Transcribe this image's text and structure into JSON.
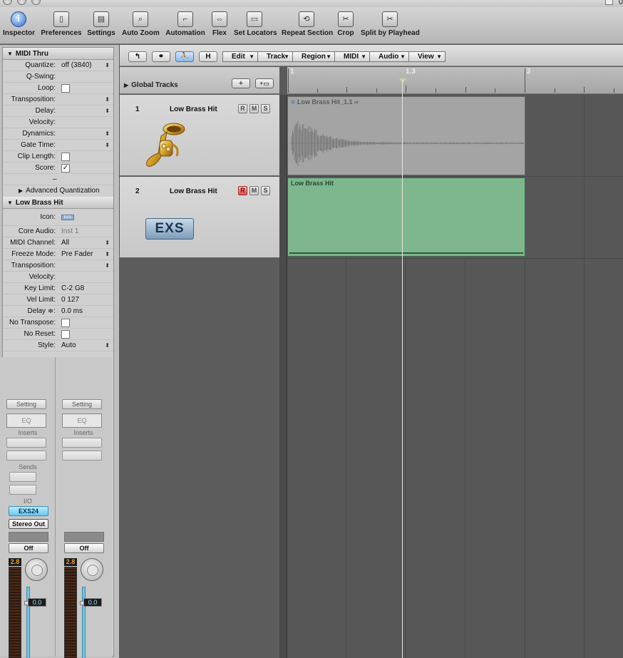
{
  "window": {
    "edge_glyph": "0"
  },
  "toolbar": {
    "items": [
      {
        "label": "Inspector",
        "glyph": "i",
        "icon": "inspector-icon"
      },
      {
        "label": "Preferences",
        "glyph": "▯",
        "icon": "preferences-icon"
      },
      {
        "label": "Settings",
        "glyph": "▤",
        "icon": "settings-icon"
      },
      {
        "label": "Auto Zoom",
        "glyph": "⌕",
        "icon": "auto-zoom-icon"
      },
      {
        "label": "Automation",
        "glyph": "⌐",
        "icon": "automation-icon"
      },
      {
        "label": "Flex",
        "glyph": "⇔",
        "icon": "flex-icon"
      },
      {
        "label": "Set Locators",
        "glyph": "▭",
        "icon": "set-locators-icon"
      },
      {
        "label": "Repeat Section",
        "glyph": "⟲",
        "icon": "repeat-section-icon"
      },
      {
        "label": "Crop",
        "glyph": "✂",
        "icon": "crop-icon"
      },
      {
        "label": "Split by Playhead",
        "glyph": "✂",
        "icon": "split-by-playhead-icon"
      }
    ]
  },
  "inspector": {
    "region_section": {
      "title": "MIDI Thru",
      "params": [
        {
          "label": "Quantize:",
          "value": "off (3840)",
          "stepper": true
        },
        {
          "label": "Q-Swing:",
          "value": ""
        },
        {
          "label": "Loop:",
          "checkbox": "",
          "is_check": true
        },
        {
          "label": "Transposition:",
          "value": "",
          "stepper": true
        },
        {
          "label": "Delay:",
          "value": "",
          "stepper": true
        },
        {
          "label": "Velocity:",
          "value": ""
        },
        {
          "label": "Dynamics:",
          "value": "",
          "stepper": true
        },
        {
          "label": "Gate Time:",
          "value": "",
          "stepper": true
        },
        {
          "label": "Clip Length:",
          "checkbox": "",
          "is_check": true
        },
        {
          "label": "Score:",
          "checkbox": "✓",
          "is_check": true
        }
      ],
      "separator": "–",
      "advanced_quantization": "Advanced Quantization"
    },
    "track_section": {
      "title": "Low Brass Hit",
      "icon_label": "Icon:",
      "icon_badge": "EXS",
      "params": [
        {
          "label": "Core Audio:",
          "value": "Inst 1",
          "dim": true
        },
        {
          "label": "MIDI Channel:",
          "value": "All",
          "stepper": true
        },
        {
          "label": "Freeze Mode:",
          "value": "Pre Fader",
          "stepper": true
        },
        {
          "label": "Transposition:",
          "value": "",
          "stepper": true
        },
        {
          "label": "Velocity:",
          "value": ""
        },
        {
          "label": "Key Limit:",
          "value": "C-2   G8"
        },
        {
          "label": "Vel Limit:",
          "value": "0       127"
        },
        {
          "label": "Delay ≑:",
          "value": "0.0 ms"
        },
        {
          "label": "No Transpose:",
          "checkbox": "",
          "is_check": true
        },
        {
          "label": "No Reset:",
          "checkbox": "",
          "is_check": true
        },
        {
          "label": "Style:",
          "value": "Auto",
          "stepper": true
        }
      ]
    },
    "strips": {
      "a": {
        "setting": "Setting",
        "eq": "EQ",
        "inserts": "Inserts",
        "sends": "Sends",
        "io": "I/O",
        "input": "EXS24",
        "output": "Stereo Out",
        "automation": "Off",
        "peak": "2.8",
        "volume": "0.0"
      },
      "b": {
        "setting": "Setting",
        "eq": "EQ",
        "inserts": "Inserts",
        "automation": "Off",
        "peak": "2.8",
        "volume": "0.0"
      }
    }
  },
  "arrange_bar": {
    "back_glyph": "↰",
    "link_glyph": "⚭",
    "catch_glyph": "⛹",
    "hide_label": "H",
    "menus": [
      "Edit",
      "Track",
      "Region",
      "MIDI",
      "Audio",
      "View"
    ]
  },
  "global_tracks": {
    "label": "Global Tracks",
    "add_glyph": "+",
    "folder_glyph": "+▭"
  },
  "ruler": {
    "marks": [
      "1",
      "1.3",
      "2"
    ]
  },
  "tracks": [
    {
      "number": "1",
      "name": "Low Brass Hit",
      "r": "R",
      "m": "M",
      "s": "S",
      "record_armed": false,
      "icon": "tuba-icon"
    },
    {
      "number": "2",
      "name": "Low Brass Hit",
      "r": "R",
      "m": "M",
      "s": "S",
      "record_armed": true,
      "icon_label": "EXS"
    }
  ],
  "regions": [
    {
      "name": "Low Brass Hit_1.1",
      "type": "audio",
      "loop_glyph": "∞"
    },
    {
      "name": "Low Brass Hit",
      "type": "midi"
    }
  ],
  "colors": {
    "midi_region": "#7eb68e",
    "audio_region": "#a4a4a4",
    "record_on": "#e04a4a",
    "input_plugin": "#67c7ef"
  }
}
